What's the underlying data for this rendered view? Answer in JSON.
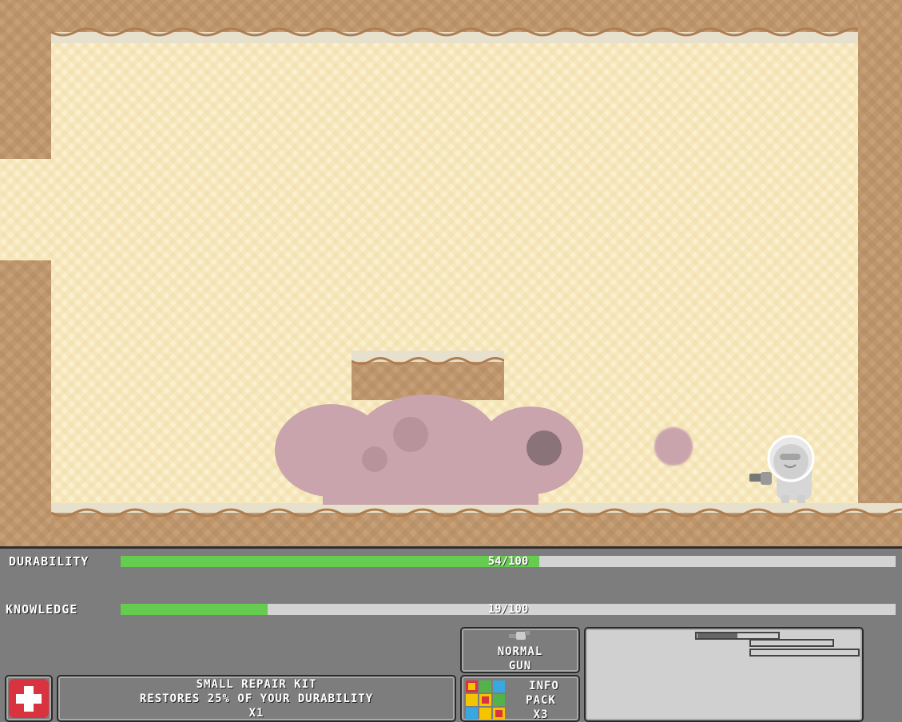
{
  "hud": {
    "durability": {
      "label": "DURABILITY",
      "value": 54,
      "max": 100,
      "text": "54/100"
    },
    "knowledge": {
      "label": "KNOWLEDGE",
      "value": 19,
      "max": 100,
      "text": "19/100"
    },
    "item": {
      "icon": "medkit-cross-icon",
      "name": "SMALL REPAIR KIT",
      "description": "RESTORES 25% OF YOUR DURABILITY",
      "count": "X1"
    },
    "weapon": {
      "icon": "gun-icon",
      "line1": "NORMAL",
      "line2": "GUN"
    },
    "info": {
      "icon": "info-pack-grid-icon",
      "line1": "INFO",
      "line2": "PACK",
      "count": "X3"
    },
    "minimap": {
      "icon": "minimap"
    }
  },
  "colors": {
    "background": "#fbf0cd",
    "dirt": "#c79f77",
    "bar_fill": "#66cc4f",
    "bar_empty": "#d3d3d3",
    "hud": "#7d7d7d",
    "enemy": "#c9a4ad"
  }
}
